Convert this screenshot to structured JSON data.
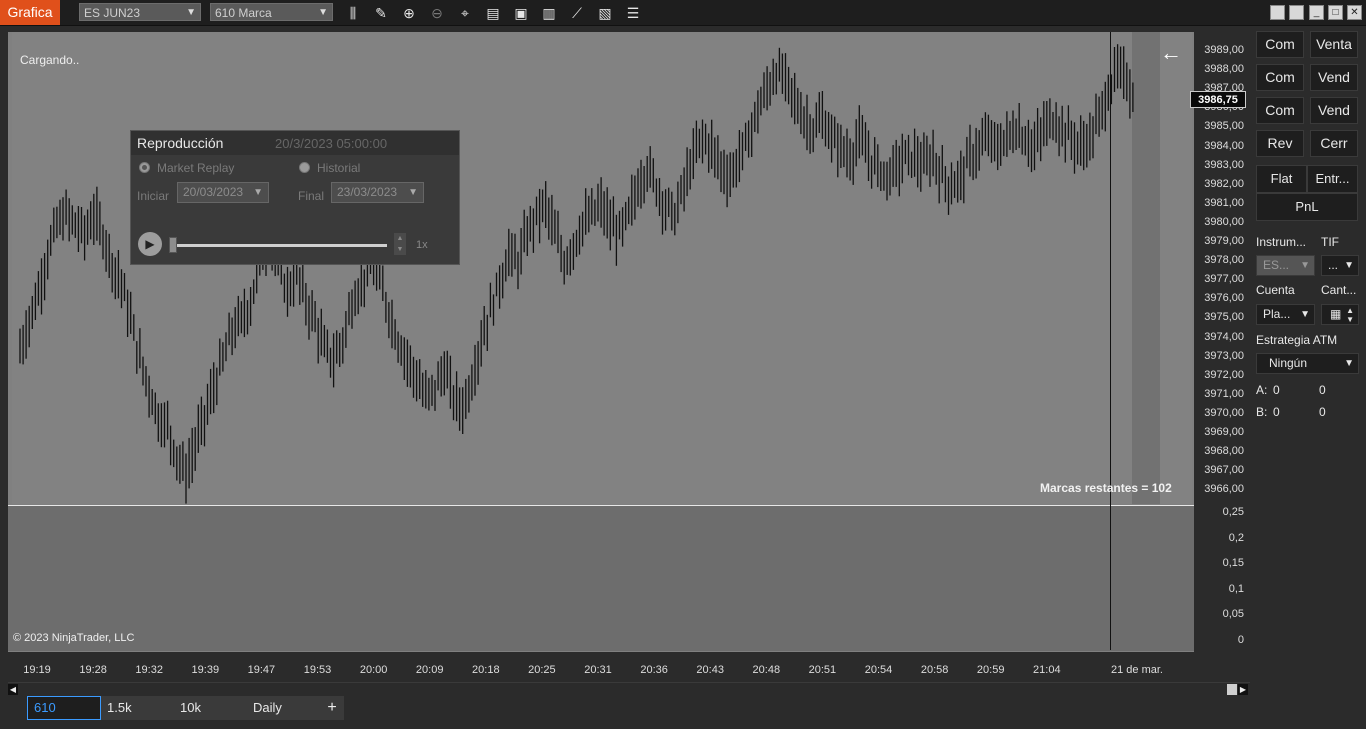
{
  "toolbar": {
    "app_title": "Grafica",
    "instrument": "ES JUN23",
    "bar_type": "610 Marca",
    "icons": [
      "data-series-icon",
      "draw-pencil-icon",
      "zoom-in-icon",
      "zoom-out-icon",
      "crosshair-icon",
      "properties-icon",
      "strategies-icon",
      "indicators-icon",
      "line-chart-icon",
      "templates-icon",
      "list-icon"
    ]
  },
  "window_controls": [
    "restore-icon",
    "restore-icon",
    "minimize-icon",
    "maximize-icon",
    "close-icon"
  ],
  "chart": {
    "status_text": "Cargando..",
    "remaining_label": "Marcas restantes = 102",
    "copyright": "© 2023 NinjaTrader, LLC",
    "current_price": "3986,75",
    "price_ticks": [
      "3989,00",
      "3988,00",
      "3987,00",
      "3986,00",
      "3985,00",
      "3984,00",
      "3983,00",
      "3982,00",
      "3981,00",
      "3980,00",
      "3979,00",
      "3978,00",
      "3977,00",
      "3976,00",
      "3975,00",
      "3974,00",
      "3973,00",
      "3972,00",
      "3971,00",
      "3970,00",
      "3969,00",
      "3968,00",
      "3967,00",
      "3966,00"
    ],
    "indicator_ticks": [
      "0,25",
      "0,2",
      "0,15",
      "0,1",
      "0,05",
      "0"
    ],
    "time_ticks": [
      "19:19",
      "19:28",
      "19:32",
      "19:39",
      "19:47",
      "19:53",
      "20:00",
      "20:09",
      "20:18",
      "20:25",
      "20:31",
      "20:36",
      "20:43",
      "20:48",
      "20:51",
      "20:54",
      "20:58",
      "20:59",
      "21:04",
      "21 de mar."
    ]
  },
  "chart_data": {
    "type": "ohlc",
    "ylim": [
      3966,
      3989.5
    ],
    "values": [
      3973.5,
      3975,
      3976.5,
      3978.5,
      3980,
      3980.5,
      3980,
      3979.5,
      3980.5,
      3979.5,
      3978,
      3977,
      3975,
      3973,
      3971.5,
      3970,
      3969.5,
      3968,
      3967,
      3968.5,
      3970,
      3971.5,
      3973,
      3974.5,
      3975,
      3976,
      3978,
      3979.5,
      3978,
      3976.5,
      3977.5,
      3976,
      3975,
      3973.5,
      3973,
      3974,
      3976,
      3977,
      3978,
      3977,
      3975.5,
      3974,
      3973,
      3972,
      3971,
      3971.5,
      3972.5,
      3971,
      3970.5,
      3972,
      3974,
      3975.5,
      3977,
      3978.5,
      3978,
      3979.5,
      3980.5,
      3981,
      3979.5,
      3978,
      3979,
      3980,
      3980.5,
      3981,
      3980,
      3979.5,
      3980.5,
      3982,
      3983,
      3982,
      3981,
      3980.5,
      3982,
      3983.5,
      3984.5,
      3984,
      3983,
      3982.5,
      3983.5,
      3984.5,
      3986,
      3987,
      3988,
      3987.5,
      3986.5,
      3985.5,
      3985,
      3985.5,
      3984.5,
      3984,
      3983.5,
      3984.5,
      3983.5,
      3983,
      3982.5,
      3983,
      3983.5,
      3983.5,
      3983,
      3983.5,
      3982.5,
      3982,
      3982.5,
      3983.5,
      3984,
      3984.5,
      3984,
      3984.5,
      3985,
      3984.5,
      3984,
      3985,
      3985.5,
      3985,
      3984.5,
      3984,
      3984.5,
      3985.5,
      3987,
      3988,
      3987.5,
      3986.5
    ]
  },
  "replay": {
    "title": "Reproducción",
    "datetime": "20/3/2023 05:00:00",
    "option_market": "Market Replay",
    "option_history": "Historial",
    "start_label": "Iniciar",
    "start_date": "20/03/2023",
    "end_label": "Final",
    "end_date": "23/03/2023",
    "speed": "1x"
  },
  "tabs": [
    "610",
    "1.5k",
    "10k",
    "Daily"
  ],
  "tab_add": "+",
  "order_panel": {
    "buttons": [
      "Com",
      "Venta",
      "Com",
      "Vend",
      "Com",
      "Vend",
      "Rev",
      "Cerr"
    ],
    "flat": "Flat",
    "entry": "Entr...",
    "pnl": "PnL",
    "instrument_label": "Instrum...",
    "tif_label": "TIF",
    "instrument_value": "ES...",
    "tif_value": "...",
    "account_label": "Cuenta",
    "qty_label": "Cant...",
    "account_value": "Pla...",
    "atm_label": "Estrategia ATM",
    "atm_value": "Ningún",
    "a_label": "A:",
    "a_val1": "0",
    "a_val2": "0",
    "b_label": "B:",
    "b_val1": "0",
    "b_val2": "0"
  }
}
